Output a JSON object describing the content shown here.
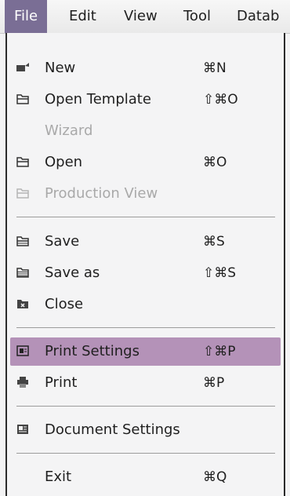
{
  "menubar": {
    "items": [
      {
        "label": "File"
      },
      {
        "label": "Edit"
      },
      {
        "label": "View"
      },
      {
        "label": "Tool"
      },
      {
        "label": "Datab"
      }
    ]
  },
  "file_menu": {
    "items": [
      {
        "label": "New",
        "shortcut": "⌘N",
        "icon": "new-document-icon",
        "enabled": true
      },
      {
        "label": "Open Template",
        "shortcut": "⇧⌘O",
        "icon": "folder-icon",
        "enabled": true
      },
      {
        "label": "Wizard",
        "shortcut": "",
        "icon": "",
        "enabled": false
      },
      {
        "label": "Open",
        "shortcut": "⌘O",
        "icon": "folder-icon",
        "enabled": true
      },
      {
        "label": "Production View",
        "shortcut": "",
        "icon": "folder-icon",
        "enabled": false
      },
      {
        "label": "Save",
        "shortcut": "⌘S",
        "icon": "save-folder-icon",
        "enabled": true
      },
      {
        "label": "Save as",
        "shortcut": "⇧⌘S",
        "icon": "save-as-icon",
        "enabled": true
      },
      {
        "label": "Close",
        "shortcut": "",
        "icon": "close-folder-icon",
        "enabled": true
      },
      {
        "label": "Print Settings",
        "shortcut": "⇧⌘P",
        "icon": "print-settings-icon",
        "enabled": true,
        "highlighted": true
      },
      {
        "label": "Print",
        "shortcut": "⌘P",
        "icon": "printer-icon",
        "enabled": true
      },
      {
        "label": "Document Settings",
        "shortcut": "",
        "icon": "document-settings-icon",
        "enabled": true
      },
      {
        "label": "Exit",
        "shortcut": "⌘Q",
        "icon": "",
        "enabled": true
      }
    ]
  },
  "colors": {
    "active_menubar": "#7a6e95",
    "highlight": "#b492b8",
    "disabled_text": "#a9a9a9",
    "separator": "#9c9c9c"
  }
}
